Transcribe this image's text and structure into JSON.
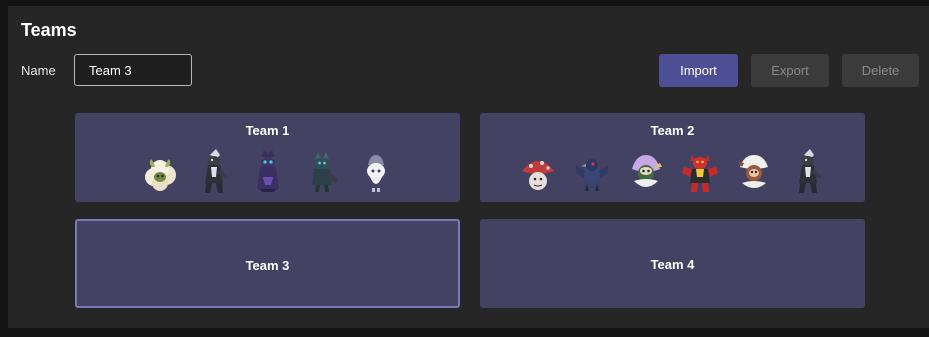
{
  "header": {
    "title": "Teams",
    "name_label": "Name",
    "name_value": "Team 3"
  },
  "actions": {
    "import_label": "Import",
    "export_label": "Export",
    "delete_label": "Delete"
  },
  "teams": [
    {
      "name": "Team 1",
      "selected": false,
      "members": [
        "whimsicott-icon",
        "toxtricity-icon",
        "mimikyu-icon",
        "grimmsnarl-icon",
        "hatenna-icon"
      ]
    },
    {
      "name": "Team 2",
      "selected": false,
      "members": [
        "amoonguss-icon",
        "corviknight-icon",
        "oranguru-icon",
        "incineroar-icon",
        "passimian-icon",
        "toxtricity-icon"
      ]
    },
    {
      "name": "Team 3",
      "selected": true,
      "members": []
    },
    {
      "name": "Team 4",
      "selected": false,
      "members": []
    }
  ],
  "colors": {
    "accent": "#4e4e94",
    "card": "#434263",
    "selected_border": "#7a7ab8",
    "panel": "#262626"
  }
}
